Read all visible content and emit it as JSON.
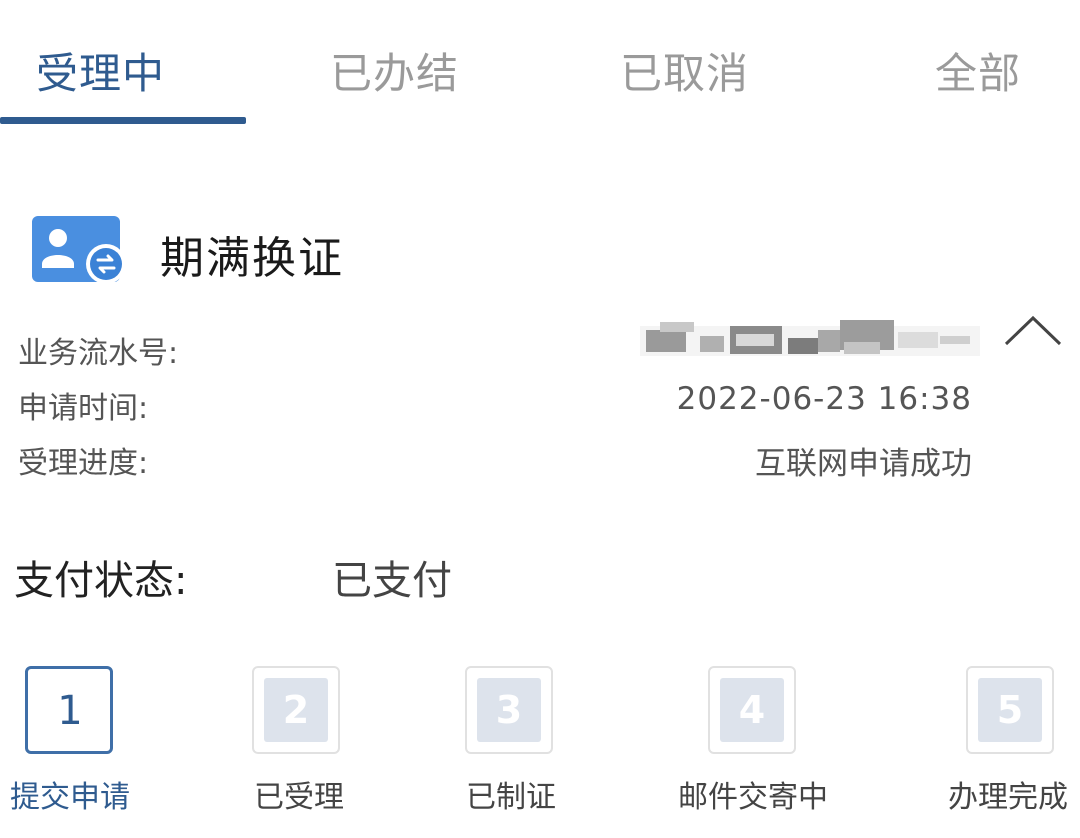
{
  "tabs": [
    {
      "label": "受理中",
      "active": true
    },
    {
      "label": "已办结",
      "active": false
    },
    {
      "label": "已取消",
      "active": false
    },
    {
      "label": "全部",
      "active": false
    }
  ],
  "service": {
    "title": "期满换证",
    "icon": "id-card-renew-icon"
  },
  "info": {
    "serial_label": "业务流水号:",
    "serial_value_redacted": true,
    "time_label": "申请时间:",
    "time_value": "2022-06-23 16:38",
    "progress_label": "受理进度:",
    "progress_value": "互联网申请成功"
  },
  "payment": {
    "label": "支付状态:",
    "value": "已支付"
  },
  "steps": [
    {
      "number": "1",
      "label": "提交申请",
      "active": true
    },
    {
      "number": "2",
      "label": "已受理",
      "active": false
    },
    {
      "number": "3",
      "label": "已制证",
      "active": false
    },
    {
      "number": "4",
      "label": "邮件交寄中",
      "active": false
    },
    {
      "number": "5",
      "label": "办理完成",
      "active": false
    }
  ],
  "colors": {
    "accent": "#2f5b8f",
    "inactive_tab": "#9a9a9a",
    "step_inactive_fill": "#dde3ec"
  }
}
